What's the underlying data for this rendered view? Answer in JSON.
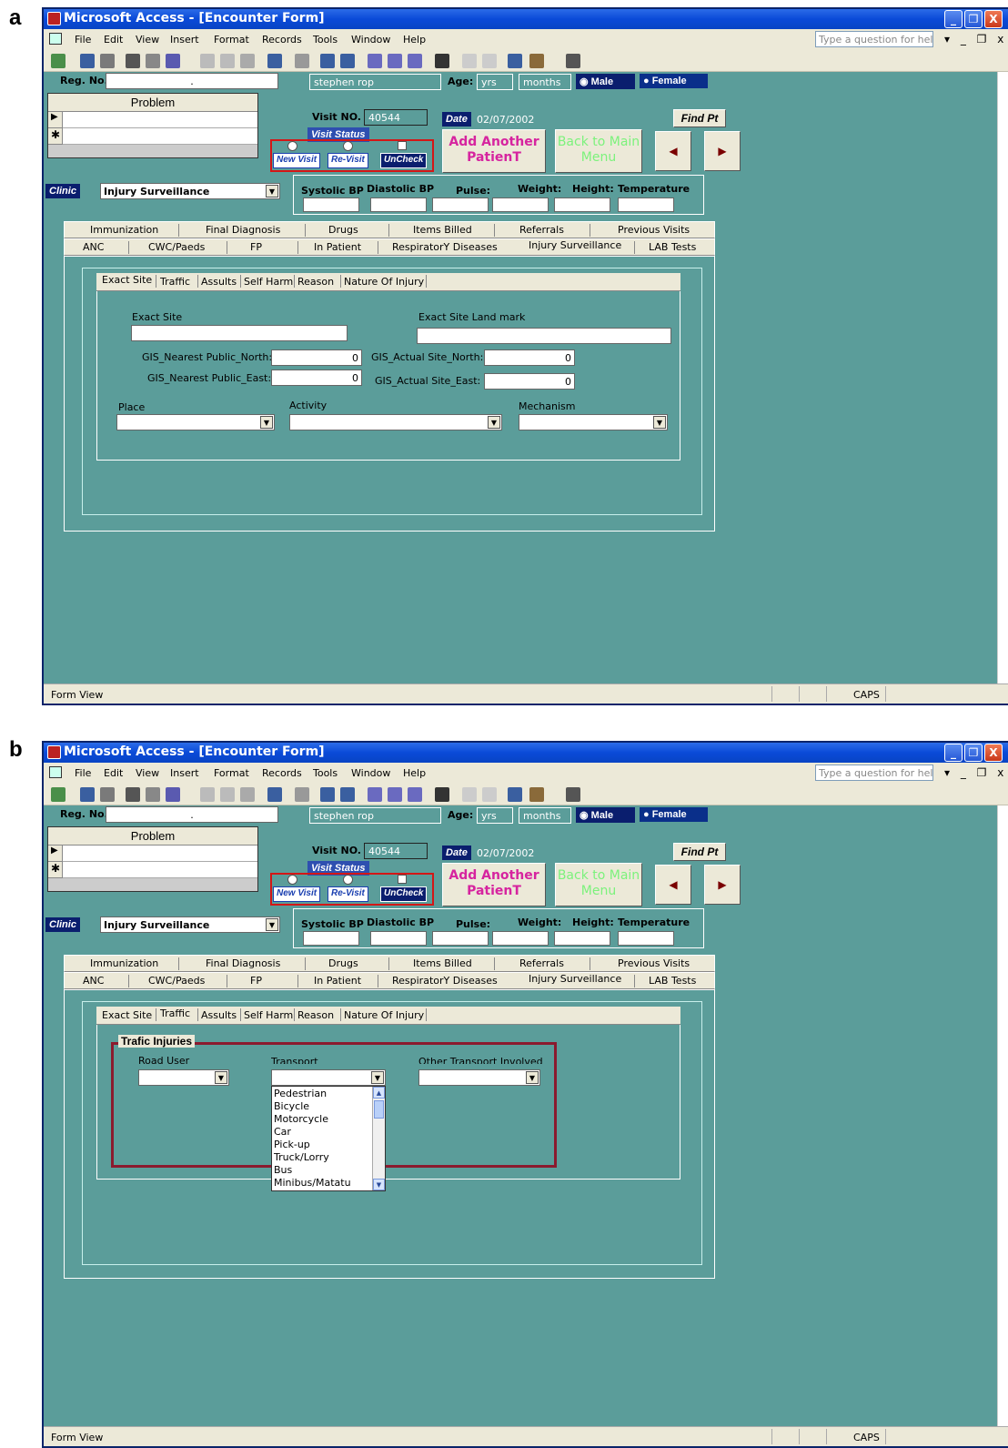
{
  "panel_labels": {
    "a": "a",
    "b": "b"
  },
  "window": {
    "title": "Microsoft Access - [Encounter Form]",
    "controls": {
      "minimize": "_",
      "restore": "❐",
      "close": "X"
    },
    "menu": [
      "File",
      "Edit",
      "View",
      "Insert",
      "Format",
      "Records",
      "Tools",
      "Window",
      "Help"
    ],
    "help_placeholder": "Type a question for help",
    "mdi_controls": "▾ _ ❐ x"
  },
  "form": {
    "reg_no_label": "Reg. No.",
    "reg_no_value": ".",
    "patient_name": "stephen rop",
    "age_label": "Age:",
    "age_years": "yrs",
    "age_months": "months",
    "gender_male": "Male",
    "gender_female": "Female",
    "problem_header": "Problem",
    "visit_no_label": "Visit NO.",
    "visit_no_value": "40544",
    "date_label": "Date",
    "date_value": "02/07/2002",
    "find_pt": "Find Pt",
    "visit_status_label": "Visit Status",
    "new_visit": "New Visit",
    "re_visit": "Re-Visit",
    "uncheck": "UnCheck",
    "add_patient_line1": "Add Another",
    "add_patient_line2": "PatienT",
    "back_main_line1": "Back to Main",
    "back_main_line2": "Menu",
    "clinic_label": "Clinic",
    "clinic_value": "Injury Surveillance",
    "vitals": [
      "Systolic BP",
      "Diastolic BP",
      "Pulse:",
      "Weight:",
      "Height:",
      "Temperature"
    ],
    "tabs_row1": [
      "Immunization",
      "Final Diagnosis",
      "Drugs",
      "Items Billed",
      "Referrals",
      "Previous Visits"
    ],
    "tabs_row2": [
      "ANC",
      "CWC/Paeds",
      "FP",
      "In Patient",
      "RespiratorY Diseases",
      "Injury Surveillance",
      "LAB Tests"
    ],
    "subtabs": [
      "Exact Site",
      "Traffic",
      "Assults",
      "Self Harm",
      "Reason",
      "Nature Of Injury"
    ]
  },
  "panel_a": {
    "exact_site_label": "Exact Site",
    "landmark_label": "Exact Site Land mark",
    "gis_np_north_label": "GIS_Nearest Public_North:",
    "gis_np_north_value": "0",
    "gis_np_east_label": "GIS_Nearest Public_East:",
    "gis_np_east_value": "0",
    "gis_as_north_label": "GIS_Actual Site_North:",
    "gis_as_north_value": "0",
    "gis_as_east_label": "GIS_Actual Site_East:",
    "gis_as_east_value": "0",
    "place_label": "Place",
    "activity_label": "Activity",
    "mechanism_label": "Mechanism"
  },
  "panel_b": {
    "frame_title": "Trafic Injuries",
    "road_user_label": "Road User",
    "transport_label": "Transport",
    "other_transport_label": "Other Transport Involved",
    "transport_options": [
      "Pedestrian",
      "Bicycle",
      "Motorcycle",
      "Car",
      "Pick-up",
      "Truck/Lorry",
      "Bus",
      "Minibus/Matatu"
    ]
  },
  "status": {
    "mode": "Form View",
    "caps": "CAPS"
  },
  "colors": {
    "form_bg": "#5b9d9a",
    "title_blue": "#0a4ad8",
    "add_patient": "#d6249f",
    "back_main": "#7cf27c",
    "frame": "#8b1a2e",
    "visit_box": "#d41616"
  }
}
